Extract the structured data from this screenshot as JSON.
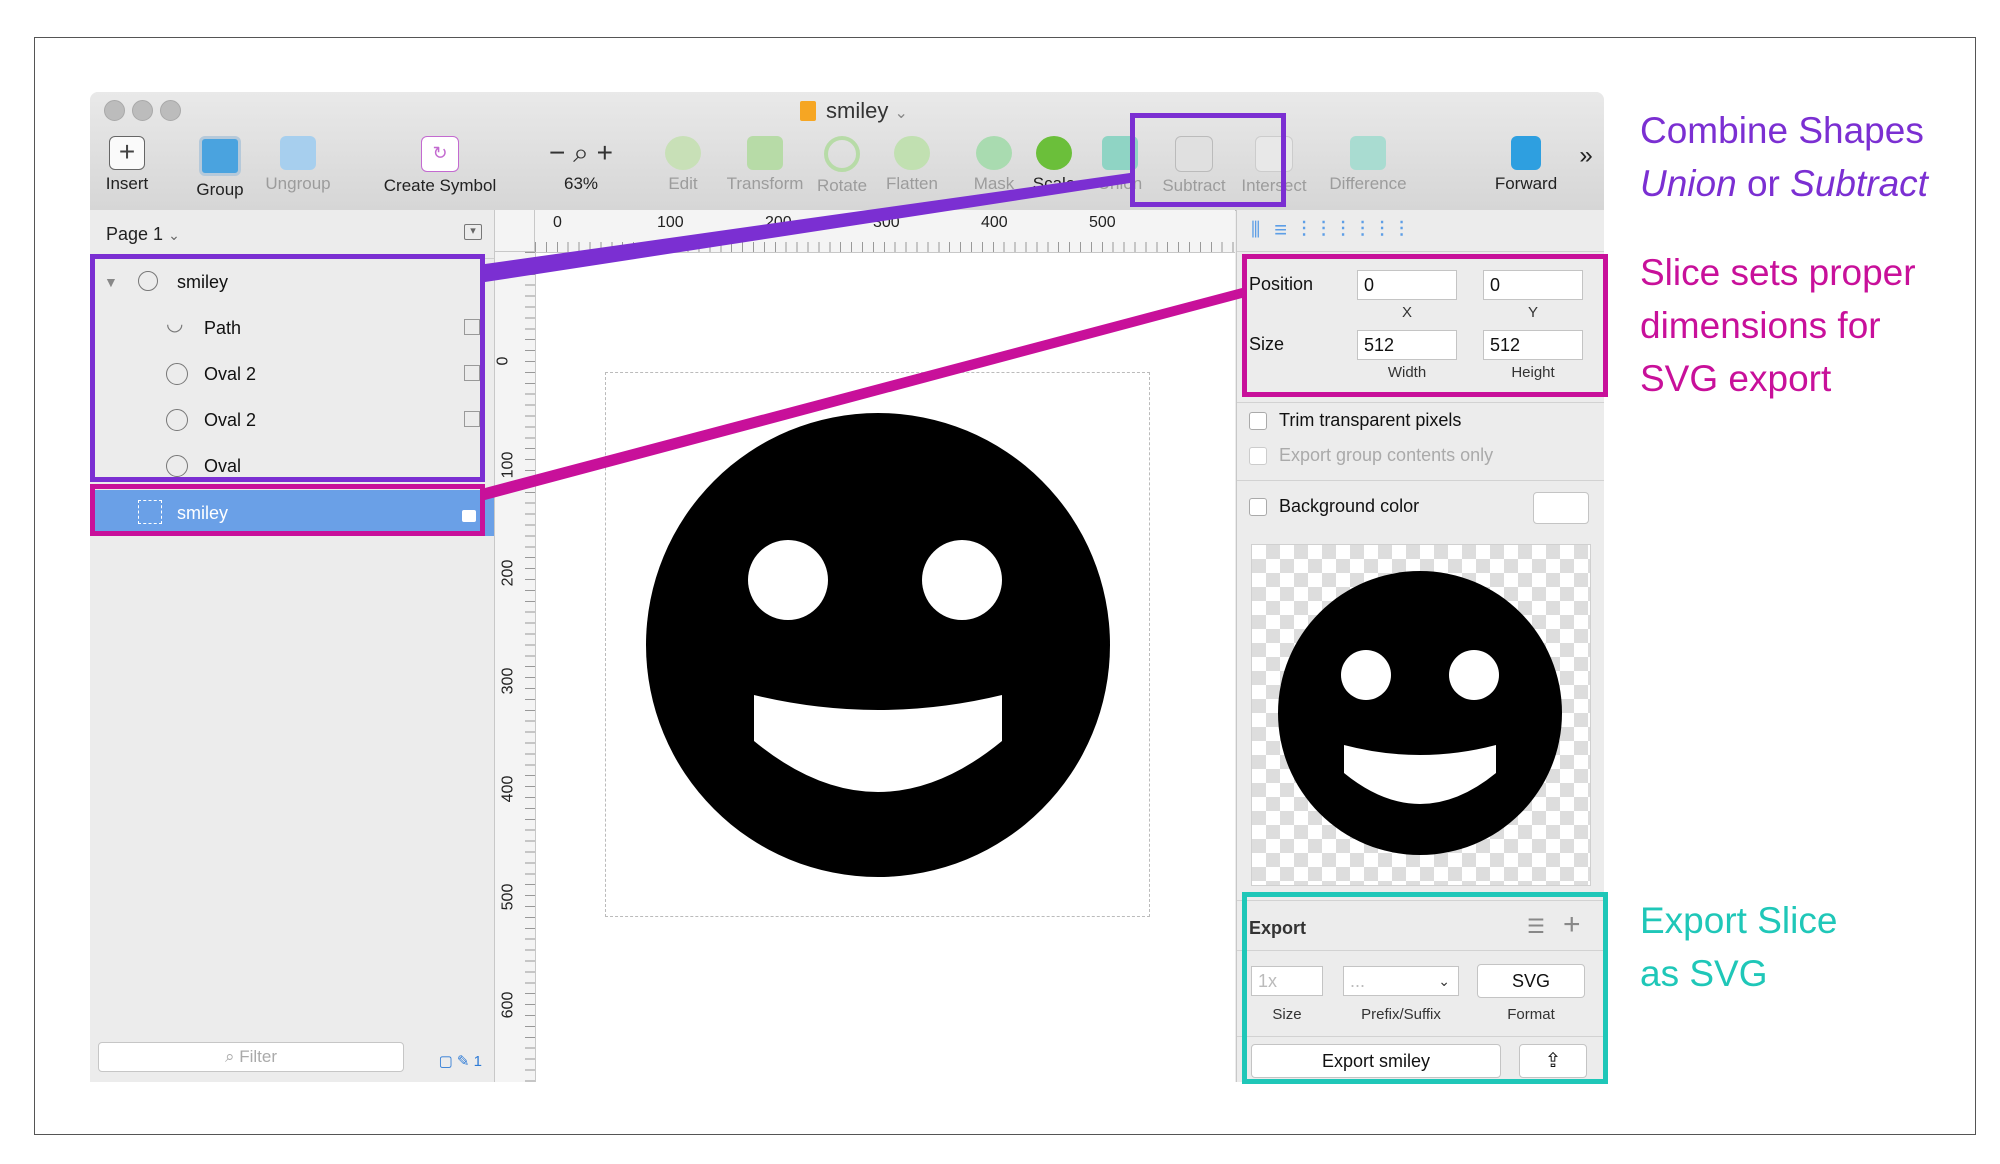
{
  "window": {
    "title": "smiley"
  },
  "toolbar": {
    "insert": "Insert",
    "group": "Group",
    "ungroup": "Ungroup",
    "create_symbol": "Create Symbol",
    "zoom": "63%",
    "edit": "Edit",
    "transform": "Transform",
    "rotate": "Rotate",
    "flatten": "Flatten",
    "mask": "Mask",
    "scale": "Scale",
    "union": "Union",
    "subtract": "Subtract",
    "intersect": "Intersect",
    "difference": "Difference",
    "forward": "Forward",
    "more": "»"
  },
  "layers": {
    "page": "Page 1",
    "items": [
      {
        "name": "smiley"
      },
      {
        "name": "Path"
      },
      {
        "name": "Oval 2"
      },
      {
        "name": "Oval 2"
      },
      {
        "name": "Oval"
      },
      {
        "name": "smiley"
      }
    ],
    "filter_placeholder": "Filter",
    "slice_count": "1"
  },
  "rulers": {
    "top": [
      "0",
      "100",
      "200",
      "300",
      "400",
      "500"
    ],
    "left": [
      "0",
      "100",
      "200",
      "300",
      "400",
      "500",
      "600"
    ]
  },
  "inspector": {
    "position_label": "Position",
    "x_value": "0",
    "y_value": "0",
    "x_label": "X",
    "y_label": "Y",
    "size_label": "Size",
    "width_value": "512",
    "height_value": "512",
    "width_label": "Width",
    "height_label": "Height",
    "trim_label": "Trim transparent pixels",
    "export_group_label": "Export group contents only",
    "background_label": "Background color"
  },
  "export": {
    "header": "Export",
    "size_placeholder": "1x",
    "prefix_placeholder": "...",
    "format_value": "SVG",
    "size_label": "Size",
    "prefix_label": "Prefix/Suffix",
    "format_label": "Format",
    "export_button": "Export smiley"
  },
  "annotations": {
    "combine_line1": "Combine Shapes",
    "combine_union": "Union",
    "combine_or": " or ",
    "combine_subtract": "Subtract",
    "slice_line1": "Slice sets proper",
    "slice_line2": "dimensions for",
    "slice_line3": "SVG export",
    "export_line1": "Export Slice",
    "export_line2": "as SVG"
  },
  "colors": {
    "purple": "#7b2fd2",
    "magenta": "#c8109a",
    "teal": "#1fc7b8",
    "selection": "#6aa0e7"
  }
}
